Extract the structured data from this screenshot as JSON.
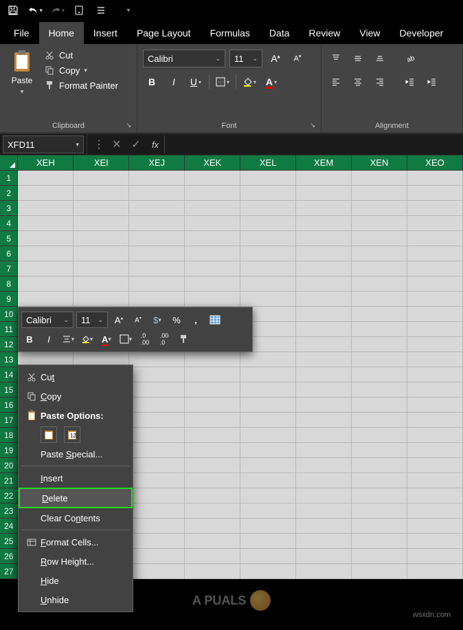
{
  "qat": {
    "tooltip_save": "Save",
    "tooltip_undo": "Undo",
    "tooltip_redo": "Redo"
  },
  "tabs": {
    "items": [
      "File",
      "Home",
      "Insert",
      "Page Layout",
      "Formulas",
      "Data",
      "Review",
      "View",
      "Developer"
    ],
    "active_index": 1
  },
  "ribbon": {
    "clipboard": {
      "paste": "Paste",
      "cut": "Cut",
      "copy": "Copy",
      "format_painter": "Format Painter",
      "group_label": "Clipboard"
    },
    "font": {
      "name": "Calibri",
      "size": "11",
      "group_label": "Font"
    },
    "alignment": {
      "group_label": "Alignment"
    }
  },
  "name_box": {
    "value": "XFD11"
  },
  "columns": [
    "XEH",
    "XEI",
    "XEJ",
    "XEK",
    "XEL",
    "XEM",
    "XEN",
    "XEO"
  ],
  "row_count": 27,
  "mini_toolbar": {
    "font": "Calibri",
    "size": "11"
  },
  "context_menu": {
    "cut": "Cut",
    "copy": "Copy",
    "paste_options_header": "Paste Options:",
    "paste_special": "Paste Special...",
    "insert": "Insert",
    "delete": "Delete",
    "clear_contents": "Clear Contents",
    "format_cells": "Format Cells...",
    "row_height": "Row Height...",
    "hide": "Hide",
    "unhide": "Unhide",
    "underlines": {
      "cut": "t",
      "copy": "C",
      "paste_special": "S",
      "insert": "I",
      "delete": "D",
      "clear_contents": "N",
      "format_cells": "F",
      "row_height": "R",
      "hide": "H",
      "unhide": "U"
    }
  },
  "watermark": {
    "site": "wsxdn.com",
    "brand": "A  PUALS"
  }
}
